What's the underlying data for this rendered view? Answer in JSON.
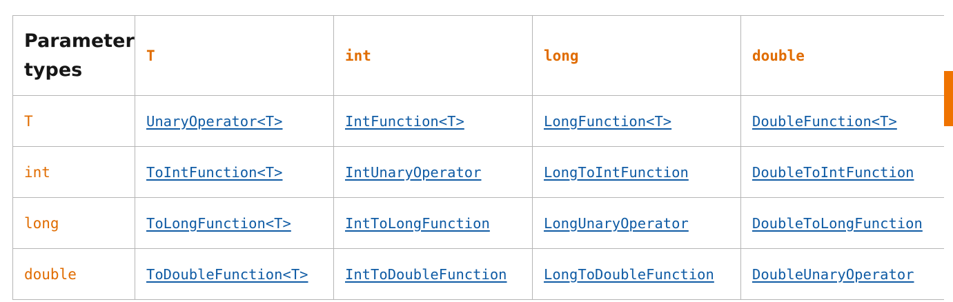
{
  "table": {
    "corner_header": "Parameter types",
    "column_headers": [
      "T",
      "int",
      "long",
      "double"
    ],
    "rows": [
      {
        "header": "T",
        "cells": [
          "UnaryOperator<T>",
          "IntFunction<T>",
          "LongFunction<T>",
          "DoubleFunction<T>"
        ]
      },
      {
        "header": "int",
        "cells": [
          "ToIntFunction<T>",
          "IntUnaryOperator",
          "LongToIntFunction",
          "DoubleToIntFunction"
        ]
      },
      {
        "header": "long",
        "cells": [
          "ToLongFunction<T>",
          "IntToLongFunction",
          "LongUnaryOperator",
          "DoubleToLongFunction"
        ]
      },
      {
        "header": "double",
        "cells": [
          "ToDoubleFunction<T>",
          "IntToDoubleFunction",
          "LongToDoubleFunction",
          "DoubleUnaryOperator"
        ]
      }
    ]
  },
  "colors": {
    "type_accent": "#e06c00",
    "link": "#0f5ba4",
    "border": "#b5b5b5",
    "scroll_indicator": "#ef7300"
  }
}
